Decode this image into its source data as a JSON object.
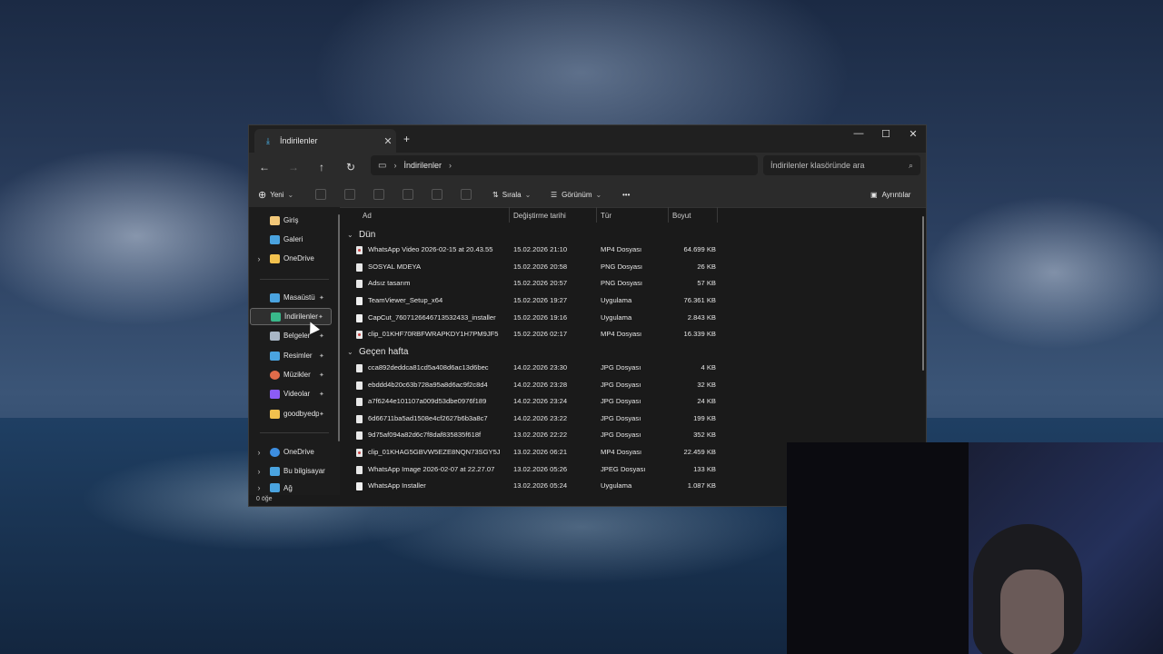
{
  "window": {
    "tab_title": "İndirilenler",
    "tab_close": "✕",
    "new_tab": "+",
    "minimize": "—",
    "maximize": "☐",
    "close": "✕"
  },
  "address": {
    "breadcrumb": "İndirilenler",
    "search_placeholder": "İndirilenler klasöründe ara"
  },
  "toolbar": {
    "new_label": "Yeni",
    "sort_label": "Sırala",
    "view_label": "Görünüm",
    "more_label": "•••",
    "details_label": "Ayrıntılar"
  },
  "sidebar": {
    "items": [
      {
        "label": "Giriş",
        "icon": "home-icon",
        "color": "#f2c879"
      },
      {
        "label": "Galeri",
        "icon": "gallery-icon",
        "color": "#4aa3df"
      },
      {
        "label": "OneDrive",
        "icon": "folder-icon",
        "color": "#f2c14e"
      },
      {
        "label": "Masaüstü",
        "icon": "desktop-icon",
        "color": "#4aa3df"
      },
      {
        "label": "İndirilenler",
        "icon": "download-icon",
        "color": "#39b88a"
      },
      {
        "label": "Belgeler",
        "icon": "documents-icon",
        "color": "#a9b7c6"
      },
      {
        "label": "Resimler",
        "icon": "pictures-icon",
        "color": "#4aa3df"
      },
      {
        "label": "Müzikler",
        "icon": "music-icon",
        "color": "#e06b4a"
      },
      {
        "label": "Videolar",
        "icon": "videos-icon",
        "color": "#8b5cf6"
      },
      {
        "label": "goodbyedpi-",
        "icon": "folder-icon",
        "color": "#f2c14e"
      },
      {
        "label": "OneDrive",
        "icon": "cloud-icon",
        "color": "#3d8ee0"
      },
      {
        "label": "Bu bilgisayar",
        "icon": "computer-icon",
        "color": "#4aa3df"
      },
      {
        "label": "Ağ",
        "icon": "network-icon",
        "color": "#4aa3df"
      }
    ]
  },
  "columns": {
    "name": "Ad",
    "date": "Değiştirme tarihi",
    "type": "Tür",
    "size": "Boyut"
  },
  "groups": [
    {
      "label": "Dün",
      "files": [
        {
          "name": "WhatsApp Video 2026-02-15 at 20.43.55",
          "date": "15.02.2026 21:10",
          "type": "MP4 Dosyası",
          "size": "64.699 KB",
          "kind": "vid"
        },
        {
          "name": "SOSYAL MDEYA",
          "date": "15.02.2026 20:58",
          "type": "PNG Dosyası",
          "size": "26 KB",
          "kind": "img"
        },
        {
          "name": "Adsız tasarım",
          "date": "15.02.2026 20:57",
          "type": "PNG Dosyası",
          "size": "57 KB",
          "kind": "img"
        },
        {
          "name": "TeamViewer_Setup_x64",
          "date": "15.02.2026 19:27",
          "type": "Uygulama",
          "size": "76.361 KB",
          "kind": "app"
        },
        {
          "name": "CapCut_7607126646713532433_installer",
          "date": "15.02.2026 19:16",
          "type": "Uygulama",
          "size": "2.843 KB",
          "kind": "app"
        },
        {
          "name": "clip_01KHF70RBFWRAPKDY1H7PM9JF5",
          "date": "15.02.2026 02:17",
          "type": "MP4 Dosyası",
          "size": "16.339 KB",
          "kind": "vid"
        }
      ]
    },
    {
      "label": "Geçen hafta",
      "files": [
        {
          "name": "cca892deddca81cd5a408d6ac13d6bec",
          "date": "14.02.2026 23:30",
          "type": "JPG Dosyası",
          "size": "4 KB",
          "kind": "img"
        },
        {
          "name": "ebddd4b20c63b728a95a8d6ac9f2c8d4",
          "date": "14.02.2026 23:28",
          "type": "JPG Dosyası",
          "size": "32 KB",
          "kind": "img"
        },
        {
          "name": "a7f6244e101107a009d53dbe0976f189",
          "date": "14.02.2026 23:24",
          "type": "JPG Dosyası",
          "size": "24 KB",
          "kind": "img"
        },
        {
          "name": "6d66711ba5ad1508e4cf2627b6b3a8c7",
          "date": "14.02.2026 23:22",
          "type": "JPG Dosyası",
          "size": "199 KB",
          "kind": "img"
        },
        {
          "name": "9d75af094a82d6c7f8daf835835f618f",
          "date": "13.02.2026 22:22",
          "type": "JPG Dosyası",
          "size": "352 KB",
          "kind": "img"
        },
        {
          "name": "clip_01KHAG5GBVW5EZE8NQN73SGY5J",
          "date": "13.02.2026 06:21",
          "type": "MP4 Dosyası",
          "size": "22.459 KB",
          "kind": "vid"
        },
        {
          "name": "WhatsApp Image 2026-02-07 at 22.27.07",
          "date": "13.02.2026 05:26",
          "type": "JPEG Dosyası",
          "size": "133 KB",
          "kind": "img"
        },
        {
          "name": "WhatsApp Installer",
          "date": "13.02.2026 05:24",
          "type": "Uygulama",
          "size": "1.087 KB",
          "kind": "app"
        }
      ]
    }
  ],
  "status": {
    "item_count": "0 öğe"
  }
}
